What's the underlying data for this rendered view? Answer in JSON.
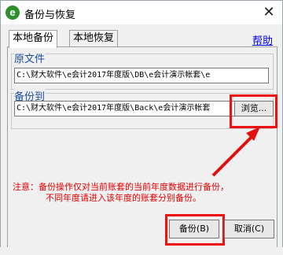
{
  "window": {
    "title": "备份与恢复",
    "app_icon_letter": "e",
    "close_label": "✕"
  },
  "tabs": [
    {
      "label": "本地备份",
      "active": true
    },
    {
      "label": "本地恢复",
      "active": false
    }
  ],
  "help": {
    "label": "帮助"
  },
  "source": {
    "label": "原文件",
    "path": "C:\\财大软件\\e会计2017年度版\\DB\\e会计演示帐套\\e"
  },
  "backup_to": {
    "label": "备份到",
    "path": "C:\\财大软件\\e会计2017年度版\\Back\\e会计演示帐套",
    "browse_label": "浏览..."
  },
  "note": {
    "line1": "注意：备份操作仅对当前账套的当前年度数据进行备份，",
    "line2": "不同年度请进入该年度的账套分别备份。"
  },
  "buttons": {
    "backup": "备份(B)",
    "cancel": "取消(C)"
  },
  "colors": {
    "annotation_red": "#e11111",
    "group_label_blue": "#1a4fa0"
  }
}
